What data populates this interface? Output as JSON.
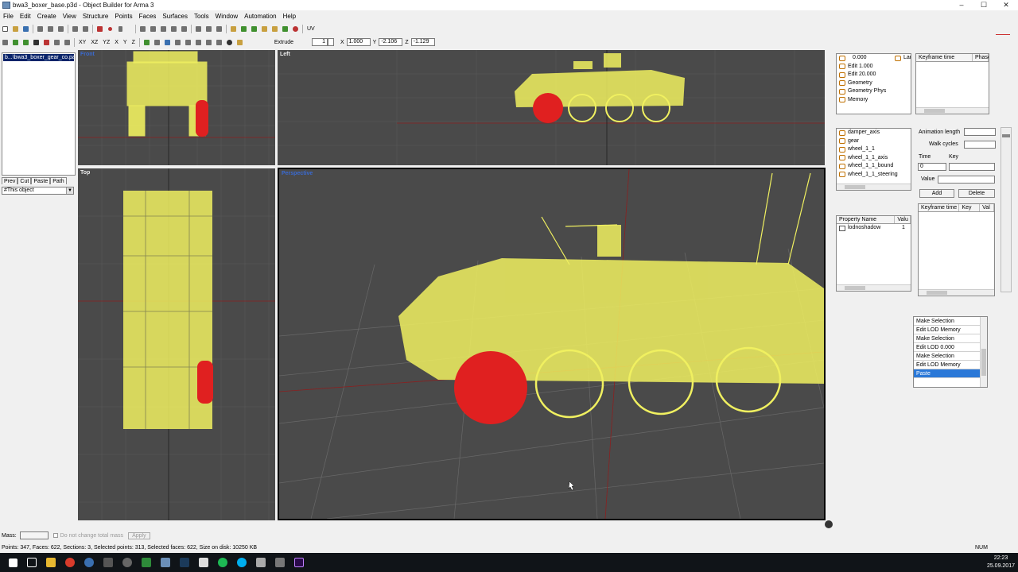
{
  "window": {
    "title": "bwa3_boxer_base.p3d - Object Builder for Arma 3",
    "minimize": "–",
    "maximize": "☐",
    "close": "✕"
  },
  "menu": [
    "File",
    "Edit",
    "Create",
    "View",
    "Structure",
    "Points",
    "Faces",
    "Surfaces",
    "Tools",
    "Window",
    "Automation",
    "Help"
  ],
  "toolbar2": {
    "axes": [
      "XY",
      "XZ",
      "YZ",
      "X",
      "Y",
      "Z"
    ],
    "extrude_label": "Extrude",
    "extrude_value": "1",
    "x_label": "X",
    "x_value": "1.000",
    "y_label": "Y",
    "y_value": "-2.106",
    "z_label": "Z",
    "z_value": "-1.129",
    "uv_label": "UV"
  },
  "left_panel": {
    "file_item": "b...\\bwa3_boxer_gear_co.paa",
    "tabs": [
      "Prev",
      "Cut",
      "Paste",
      "Path"
    ],
    "dropdown_value": "#This object"
  },
  "viewports": {
    "front_label": "Front",
    "left_label": "Left",
    "top_label": "Top",
    "persp_label": "Perspective"
  },
  "lod_list": {
    "items": [
      "0.000",
      "Edit 1.000",
      "Edit 20.000",
      "Geometry",
      "Geometry Phys",
      "Memory"
    ],
    "lar_label": "Lar"
  },
  "keyframe_top": {
    "col1": "Keyframe time",
    "col2": "Phase"
  },
  "selections": {
    "items": [
      "damper_axis",
      "gear",
      "wheel_1_1",
      "wheel_1_1_axis",
      "wheel_1_1_bound",
      "wheel_1_1_steering"
    ]
  },
  "animation": {
    "anim_length_label": "Animation length",
    "walk_cycles_label": "Walk cycles",
    "time_label": "Time",
    "key_label": "Key",
    "time_value": "0",
    "value_label": "Value",
    "add_button": "Add",
    "delete_button": "Delete",
    "kf_col1": "Keyframe time",
    "kf_col2": "Key",
    "kf_col3": "Val"
  },
  "properties": {
    "col_name": "Property Name",
    "col_value": "Valu",
    "rows": [
      {
        "name": "lodnoshadow",
        "value": "1"
      }
    ]
  },
  "history": {
    "items": [
      "Make Selection",
      "Edit LOD Memory",
      "Make Selection",
      "Edit LOD   0.000",
      "Make Selection",
      "Edit LOD Memory",
      "Paste"
    ],
    "selected_index": 6
  },
  "massbar": {
    "mass_label": "Mass:",
    "checkbox_label": "Do not change total mass",
    "apply_button": "Apply"
  },
  "status": {
    "text": "Points: 347, Faces: 622, Sections: 3, Selected points: 313, Selected faces: 622, Size on disk: 10250 KB",
    "num": "NUM"
  },
  "taskbar": {
    "time": "22:23",
    "date": "25.09.2017"
  },
  "colors": {
    "wire": "#f0f060",
    "selected": "#e02020",
    "viewport_bg": "#4a4a4a"
  }
}
